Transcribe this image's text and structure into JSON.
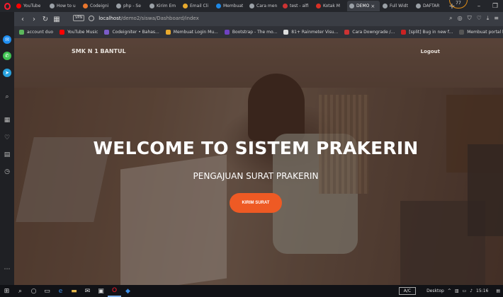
{
  "browser": {
    "tabs": [
      {
        "label": "YouTube",
        "color": "#ff0000"
      },
      {
        "label": "How to u",
        "color": "#9aa0a6"
      },
      {
        "label": "Codeigni",
        "color": "#e8762d"
      },
      {
        "label": "php - Se",
        "color": "#9aa0a6"
      },
      {
        "label": "Kirim Em",
        "color": "#9aa0a6"
      },
      {
        "label": "Email Cli",
        "color": "#e8a92d"
      },
      {
        "label": "Membuat",
        "color": "#1e88e5"
      },
      {
        "label": "Cara men",
        "color": "#9aa0a6"
      },
      {
        "label": "test - alfi",
        "color": "#cc3333"
      },
      {
        "label": "Kotak M",
        "color": "#d93025"
      },
      {
        "label": "DEMO",
        "color": "#9aa0a6"
      },
      {
        "label": "Full Widt",
        "color": "#9aa0a6"
      },
      {
        "label": "DAFTAR",
        "color": "#9aa0a6"
      }
    ],
    "active_tab_index": 10,
    "vpn_badge": "77",
    "vpn_label": "VPN",
    "url_host": "localhost",
    "url_path": "/demo2/siswa/Dashboard/index",
    "bookmarks": [
      {
        "label": "account duo",
        "color": "#5cb85c"
      },
      {
        "label": "YouTube Music",
        "color": "#ff0000"
      },
      {
        "label": "Codeigniter • Bahas...",
        "color": "#7b5cc7"
      },
      {
        "label": "Membuat Login Mu...",
        "color": "#e8a92d"
      },
      {
        "label": "Bootstrap - The mo...",
        "color": "#6f42c1"
      },
      {
        "label": "81+ Rainmeter Visu...",
        "color": "#dddddd"
      },
      {
        "label": "Cara Downgrade /...",
        "color": "#cc3333"
      },
      {
        "label": "[split] Bug in new f...",
        "color": "#cc2222"
      },
      {
        "label": "Membuat portal be...",
        "color": "#555555"
      }
    ]
  },
  "site": {
    "brand": "SMK N 1 BANTUL",
    "logout": "Logout",
    "hero_title": "WELCOME TO SISTEM PRAKERIN",
    "hero_subtitle": "PENGAJUAN SURAT PRAKERIN",
    "cta_label": "KIRIM SURAT"
  },
  "taskbar": {
    "keyboard": "A/C",
    "desktop": "Desktop",
    "time": "15:16"
  }
}
